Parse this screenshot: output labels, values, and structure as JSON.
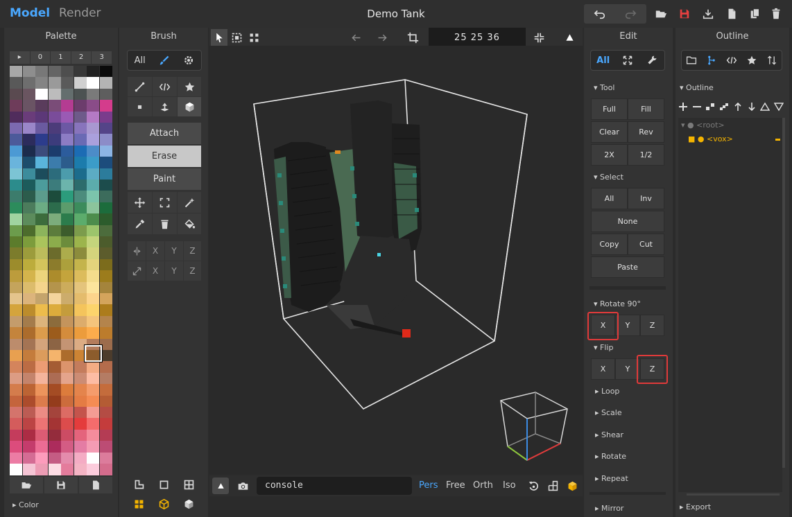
{
  "topbar": {
    "tab_model": "Model",
    "tab_render": "Render",
    "title": "Demo Tank"
  },
  "palette": {
    "title": "Palette",
    "header": [
      "▸",
      "0",
      "1",
      "2",
      "3"
    ],
    "footer_label": "Color",
    "rows": [
      [
        "#a8a8a8",
        "#8e8e8e",
        "#787878",
        "#646464",
        "#4e4e4e",
        "#383838",
        "#222222",
        "#0a0a0a"
      ],
      [
        "#595959",
        "#6e6e6e",
        "#848484",
        "#9a9a9a",
        "#5a5a5a",
        "#d0d0d0",
        "#ffffff",
        "#b4b4b4"
      ],
      [
        "#5a4a50",
        "#6a5560",
        "#ffffff",
        "#bcbcbc",
        "#646e6e",
        "#4c5252",
        "#7a7a7a",
        "#5e5e5e"
      ],
      [
        "#6e3c5a",
        "#6a5464",
        "#5a3c5c",
        "#7a4c78",
        "#b43c92",
        "#6c3c6c",
        "#8a4c88",
        "#d43c8c"
      ],
      [
        "#502c5c",
        "#6a3c7a",
        "#5c3878",
        "#7a4c9a",
        "#9a5ab4",
        "#6e5a8a",
        "#b47ac4",
        "#7a3c8c"
      ],
      [
        "#7c6ab0",
        "#9a86c8",
        "#6a5aa0",
        "#4c3c7a",
        "#6c58a4",
        "#8874bc",
        "#a898d0",
        "#544488"
      ],
      [
        "#4c5a9a",
        "#2c2c5c",
        "#2c3c8c",
        "#3c3c7c",
        "#8c7cc4",
        "#6a6ab4",
        "#aaa0dc",
        "#8c8cc8"
      ],
      [
        "#4c9ad4",
        "#1c2c4c",
        "#3c4c7c",
        "#1c3c6c",
        "#2c5c9c",
        "#1c6cb4",
        "#4c8cc8",
        "#8cb4e4"
      ],
      [
        "#6ab4dc",
        "#1c4c6c",
        "#5ab4dc",
        "#3c7cac",
        "#2c5c8c",
        "#1c7cac",
        "#3c9cc8",
        "#1c4c7c"
      ],
      [
        "#7cc4d4",
        "#3c8c9c",
        "#1c4c5c",
        "#2c6c7c",
        "#4c9cac",
        "#1c6c8c",
        "#5cacc4",
        "#2c7c9c"
      ],
      [
        "#2c8c8c",
        "#1c5c5c",
        "#4c9c9c",
        "#3c7c7c",
        "#6cb4ac",
        "#2c6c6c",
        "#5cacac",
        "#1c4c4c"
      ],
      [
        "#3c7c6c",
        "#2c5c4c",
        "#5c9c8c",
        "#1c4c3c",
        "#2c9c7c",
        "#4c8c7c",
        "#7cc4ac",
        "#3c6c5c"
      ],
      [
        "#2c8c5c",
        "#4c7c5c",
        "#6cac84",
        "#2c6c4c",
        "#5c9c6c",
        "#3c8c5c",
        "#8cc49c",
        "#1c6c3c"
      ],
      [
        "#a0d4a0",
        "#5c8c5c",
        "#3c6c3c",
        "#7cac7c",
        "#2c7c4c",
        "#5cac6c",
        "#4c8c4c",
        "#2c5c2c"
      ],
      [
        "#6c9c4c",
        "#4c6c2c",
        "#8cb45c",
        "#5c7c3c",
        "#3c5c2c",
        "#7c9c4c",
        "#9cc46c",
        "#4c6c3c"
      ],
      [
        "#5c7c2c",
        "#7c9c3c",
        "#aac45c",
        "#8cac4c",
        "#6c8c3c",
        "#9cb44c",
        "#c4d47c",
        "#4c5c2c"
      ],
      [
        "#7c7c2c",
        "#9c9c3c",
        "#bcbc5c",
        "#6c6c2c",
        "#acac4c",
        "#8c8c3c",
        "#d4d47c",
        "#5c5c2c"
      ],
      [
        "#9c8c2c",
        "#bcac3c",
        "#d4c45c",
        "#8c7c2c",
        "#aca03c",
        "#c4b44c",
        "#e4d47c",
        "#7c6c1c"
      ],
      [
        "#bc9c3c",
        "#d4b44c",
        "#ecd47c",
        "#ac8c2c",
        "#c4a43c",
        "#dcbc5c",
        "#f4dc8c",
        "#9c7c1c"
      ],
      [
        "#c4a45c",
        "#dcbc6c",
        "#f4d48c",
        "#b4944c",
        "#ccac5c",
        "#e4c47c",
        "#fce49c",
        "#a4843c"
      ],
      [
        "#e4c48c",
        "#dcb47c",
        "#c4a46c",
        "#f4d49c",
        "#ccac6c",
        "#e4bc6c",
        "#fcd48c",
        "#d4a45c"
      ],
      [
        "#d4a43c",
        "#bc8c2c",
        "#ecbc4c",
        "#dcac3c",
        "#c49c3c",
        "#f4c45c",
        "#fcd46c",
        "#ac7c1c"
      ],
      [
        "#c49c6c",
        "#a47c4c",
        "#dcb47c",
        "#8c6c3c",
        "#c4945c",
        "#dcac6c",
        "#f4c47c",
        "#b4844c"
      ],
      [
        "#c4843c",
        "#ac6c2c",
        "#dc9c4c",
        "#9c5c1c",
        "#d48c3c",
        "#ec9c3c",
        "#fcac4c",
        "#bc7c2c"
      ],
      [
        "#bc8c6c",
        "#a47454",
        "#d4a47c",
        "#8c6444",
        "#c49474",
        "#dcac84",
        "#b47c5c",
        "#9c6c4c"
      ],
      [
        "#e8a050",
        "#c47c3c",
        "#dc9c5c",
        "#f4b46c",
        "#ac6c2c",
        "#cc8434",
        "#8c5c2c",
        "#4c3c2c"
      ],
      [
        "#d4845c",
        "#bc6c44",
        "#ec9c74",
        "#a45c34",
        "#dc946c",
        "#c47c5c",
        "#f4ac84",
        "#b46c4c"
      ],
      [
        "#dc9c84",
        "#c4846c",
        "#f4b49c",
        "#ac6c54",
        "#e4a48c",
        "#cc8c74",
        "#fcbca4",
        "#b47c64"
      ],
      [
        "#d47c4c",
        "#bc6434",
        "#ec945c",
        "#a44c24",
        "#dc7c3c",
        "#e4844c",
        "#f49c6c",
        "#c46c3c"
      ],
      [
        "#c4643c",
        "#ac4c2c",
        "#dc7c4c",
        "#943c1c",
        "#cc6c3c",
        "#e47c44",
        "#f48c54",
        "#b45c34"
      ],
      [
        "#d4746c",
        "#bc5c54",
        "#ec8c84",
        "#a4443c",
        "#dc6c64",
        "#c4544c",
        "#f49c94",
        "#b44c44"
      ],
      [
        "#d45c5c",
        "#bc4444",
        "#ec7474",
        "#a43434",
        "#dc4c4c",
        "#e43c3c",
        "#f46c6c",
        "#c43c3c"
      ],
      [
        "#c43c5c",
        "#ac2c44",
        "#dc5c74",
        "#942c3c",
        "#cc4c64",
        "#e4647c",
        "#f48c9c",
        "#b43c54"
      ],
      [
        "#dc4c7c",
        "#c43c6c",
        "#ec6c94",
        "#ac2c5c",
        "#d45c84",
        "#e47ca4",
        "#f49cb4",
        "#bc4c74"
      ],
      [
        "#ec7ca4",
        "#d46c94",
        "#fc9cbc",
        "#c45c84",
        "#e48cac",
        "#f4acc4",
        "#ffffff",
        "#dc7c9c"
      ],
      [
        "#ffffff",
        "#f4c4d4",
        "#ec9cb4",
        "#fcdce4",
        "#e47c9c",
        "#f4b4c4",
        "#fcccdc",
        "#d46c8c"
      ]
    ]
  },
  "brush": {
    "title": "Brush",
    "seg_all": "All",
    "attach": "Attach",
    "erase": "Erase",
    "paint": "Paint",
    "axis": [
      "X",
      "Y",
      "Z"
    ]
  },
  "viewport": {
    "coords": "25  25  36",
    "console_value": "console",
    "cameras": [
      "Pers",
      "Free",
      "Orth",
      "Iso"
    ]
  },
  "edit": {
    "title": "Edit",
    "seg_all": "All",
    "tool_label": "Tool",
    "tool_buttons": [
      "Full",
      "Fill",
      "Clear",
      "Rev",
      "2X",
      "1/2"
    ],
    "select_label": "Select",
    "select_all": "All",
    "select_inv": "Inv",
    "select_none": "None",
    "copy": "Copy",
    "cut": "Cut",
    "paste": "Paste",
    "rotate_label": "Rotate 90°",
    "flip_label": "Flip",
    "axis": [
      "X",
      "Y",
      "Z"
    ],
    "collapsed": [
      "Loop",
      "Scale",
      "Shear",
      "Rotate",
      "Repeat",
      "Mirror"
    ]
  },
  "outline": {
    "title": "Outline",
    "section": "Outline",
    "root": "<root>",
    "vox": "<vox>",
    "export": "Export"
  },
  "colors": {
    "accent": "#4aa8ff",
    "highlight": "#e03a3a",
    "vox": "#f4b400"
  }
}
